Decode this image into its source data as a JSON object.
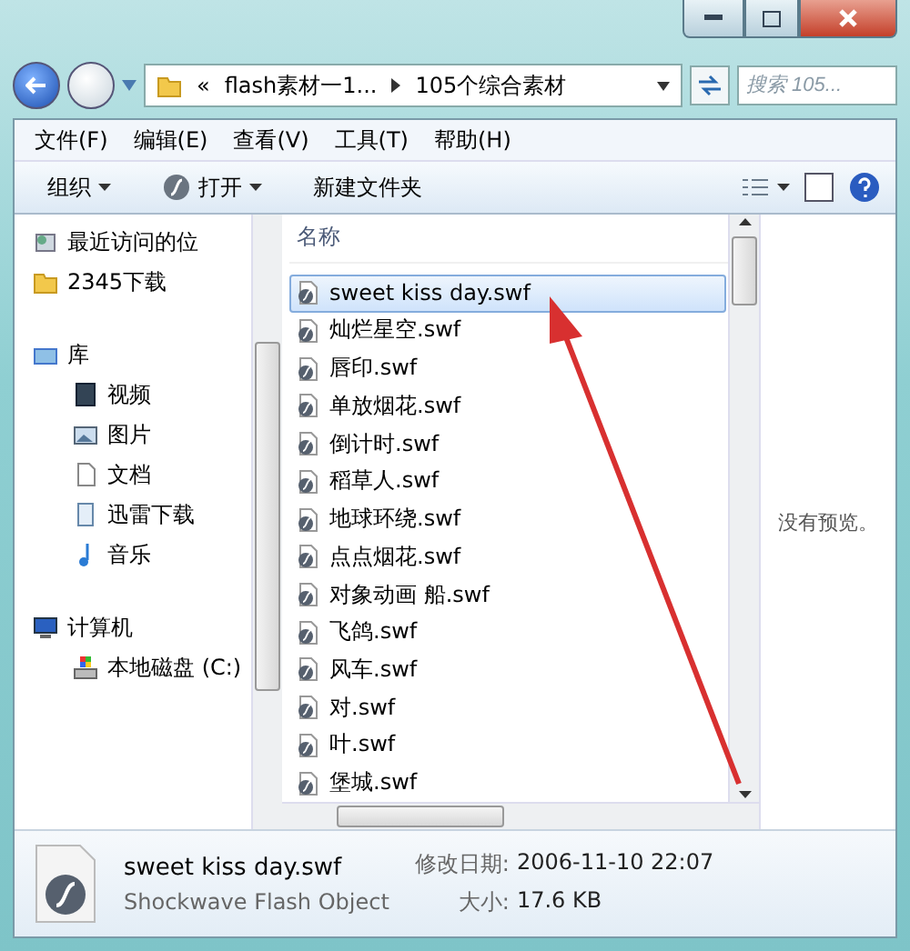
{
  "address": {
    "parts": [
      "«",
      "flash素材一1...",
      "105个综合素材"
    ]
  },
  "search": {
    "placeholder": "搜索 105..."
  },
  "menu": [
    "文件(F)",
    "编辑(E)",
    "查看(V)",
    "工具(T)",
    "帮助(H)"
  ],
  "toolbar": [
    {
      "label": "组织",
      "kind": "menu"
    },
    {
      "label": "打开",
      "kind": "open"
    },
    {
      "label": "新建文件夹",
      "kind": "plain"
    }
  ],
  "nav": [
    {
      "label": "最近访问的位",
      "kind": "recent"
    },
    {
      "label": "2345下载",
      "kind": "folder"
    },
    {
      "label": "库",
      "kind": "library",
      "children": [
        {
          "label": "视频",
          "kind": "video"
        },
        {
          "label": "图片",
          "kind": "picture"
        },
        {
          "label": "文档",
          "kind": "document"
        },
        {
          "label": "迅雷下载",
          "kind": "download"
        },
        {
          "label": "音乐",
          "kind": "music"
        }
      ]
    },
    {
      "label": "计算机",
      "kind": "computer",
      "children": [
        {
          "label": "本地磁盘 (C:)",
          "kind": "drive"
        }
      ]
    }
  ],
  "files": {
    "column": "名称",
    "rows": [
      {
        "name": "sweet kiss day.swf",
        "selected": true
      },
      {
        "name": "灿烂星空.swf",
        "selected": false
      },
      {
        "name": "唇印.swf",
        "selected": false
      },
      {
        "name": "单放烟花.swf",
        "selected": false
      },
      {
        "name": "倒计时.swf",
        "selected": false
      },
      {
        "name": "稻草人.swf",
        "selected": false
      },
      {
        "name": "地球环绕.swf",
        "selected": false
      },
      {
        "name": "点点烟花.swf",
        "selected": false
      },
      {
        "name": "对象动画 船.swf",
        "selected": false
      },
      {
        "name": "飞鸽.swf",
        "selected": false
      },
      {
        "name": "风车.swf",
        "selected": false
      },
      {
        "name": "对.swf",
        "selected": false
      },
      {
        "name": "叶.swf",
        "selected": false
      },
      {
        "name": "堡城.swf",
        "selected": false
      }
    ]
  },
  "preview": "没有预览。",
  "details": {
    "name": "sweet kiss day.swf",
    "type": "Shockwave Flash Object",
    "date_label": "修改日期:",
    "date": "2006-11-10 22:07",
    "size_label": "大小:",
    "size": "17.6 KB"
  }
}
